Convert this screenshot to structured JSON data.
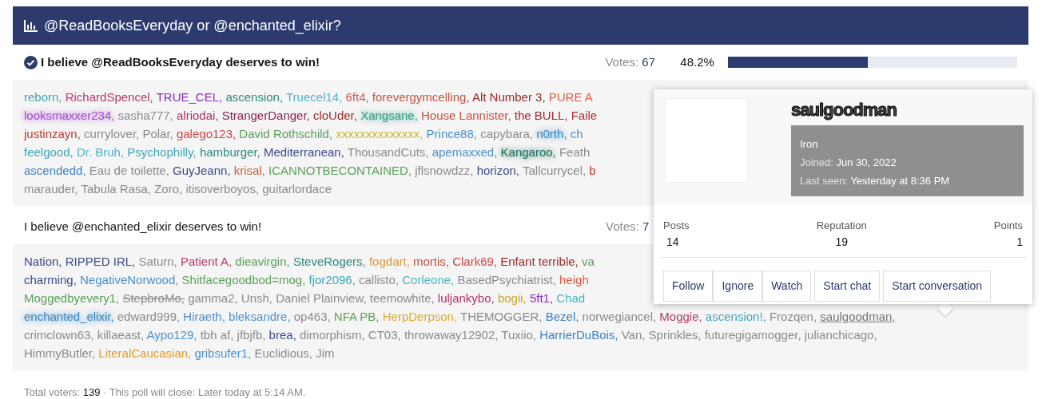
{
  "poll": {
    "title": "@ReadBooksEveryday or @enchanted_elixir?"
  },
  "options": [
    {
      "text": "I believe @ReadBooksEveryday deserves to win!",
      "selected": true,
      "votes_label": "Votes:",
      "votes": "67",
      "percent": "48.2%",
      "level": 0.482,
      "voter_lines": [
        [
          {
            "name": "reborn,",
            "color": "#3ea6b8"
          },
          {
            "name": "RichardSpencel,",
            "color": "#b83869"
          },
          {
            "name": "TRUE_CEL,",
            "color": "#8a2bc2"
          },
          {
            "name": "ascension,",
            "color": "#2a8a78"
          },
          {
            "name": "Truecel14,",
            "color": "#4bb5c6"
          },
          {
            "name": "6ft4,",
            "color": "#d9534f"
          },
          {
            "name": "forevergymcelling,",
            "color": "#c4533f"
          },
          {
            "name": "Alt Number 3,",
            "color": "#a02828"
          },
          {
            "name": "PURE A",
            "color": "#e8583f"
          }
        ],
        [
          {
            "name": "looksmaxxer234,",
            "color": "#a64fd0",
            "kind": "glow"
          },
          {
            "name": "sasha777,",
            "color": "#8a8a8a"
          },
          {
            "name": "alriodai,",
            "color": "#a8336b"
          },
          {
            "name": "StrangerDanger,",
            "color": "#8a2050"
          },
          {
            "name": "cloUder,",
            "color": "#9c2a2a"
          },
          {
            "name": "Xangsane,",
            "color": "#2e9e88",
            "kind": "glow"
          },
          {
            "name": "House Lannister,",
            "color": "#c9503c"
          },
          {
            "name": "the BULL,",
            "color": "#a02828"
          },
          {
            "name": "Faile",
            "color": "#b03030"
          }
        ],
        [
          {
            "name": "justinzayn,",
            "color": "#c0392b"
          },
          {
            "name": "currylover,",
            "color": "#8a8a8a"
          },
          {
            "name": "Polar,",
            "color": "#8a8a8a"
          },
          {
            "name": "galego123,",
            "color": "#d04545"
          },
          {
            "name": "David Rothschild,",
            "color": "#5aa05a"
          },
          {
            "name": "xxxxxxxxxxxxxx,",
            "color": "#c8b82a"
          },
          {
            "name": "Prince88,",
            "color": "#4a90d0"
          },
          {
            "name": "capybara,",
            "color": "#8a8a8a"
          },
          {
            "name": "n0rth,",
            "color": "#3a8ac8",
            "kind": "glow"
          },
          {
            "name": "ch",
            "color": "#4a90d0"
          }
        ],
        [
          {
            "name": "feelgood,",
            "color": "#3ea6b8"
          },
          {
            "name": "Dr. Bruh,",
            "color": "#4ab5c6"
          },
          {
            "name": "Psychophilly,",
            "color": "#3ea6b8"
          },
          {
            "name": "hamburger,",
            "color": "#2a8a78"
          },
          {
            "name": "Mediterranean,",
            "color": "#3a4a8a"
          },
          {
            "name": "ThousandCuts,",
            "color": "#8a8a8a"
          },
          {
            "name": "apemaxxed,",
            "color": "#4a90d0"
          },
          {
            "name": "Kangaroo,",
            "color": "#1f6f5f",
            "kind": "glow"
          },
          {
            "name": "Feath",
            "color": "#8a8a8a"
          }
        ],
        [
          {
            "name": "ascendedd,",
            "color": "#3a7fc8"
          },
          {
            "name": "Eau de toilette,",
            "color": "#8a8a8a"
          },
          {
            "name": "GuyJeann,",
            "color": "#3a4a8a"
          },
          {
            "name": "krisal,",
            "color": "#d0603a"
          },
          {
            "name": "ICANNOTBECONTAINED,",
            "color": "#5aa05a"
          },
          {
            "name": "jflsnowdzz,",
            "color": "#8a8a8a"
          },
          {
            "name": "horizon,",
            "color": "#3a4a8a"
          },
          {
            "name": "Tallcurrycel,",
            "color": "#8a8a8a"
          },
          {
            "name": "b",
            "color": "#c0392b"
          }
        ],
        [
          {
            "name": "marauder,",
            "color": "#8a8a8a"
          },
          {
            "name": "Tabula Rasa,",
            "color": "#8a8a8a"
          },
          {
            "name": "Zoro,",
            "color": "#8a8a8a"
          },
          {
            "name": "itisoverboyos,",
            "color": "#8a8a8a"
          },
          {
            "name": "guitarlordace",
            "color": "#8a8a8a"
          }
        ]
      ]
    },
    {
      "text": "I believe @enchanted_elixir deserves to win!",
      "selected": false,
      "votes_label": "Votes:",
      "votes": "7",
      "voter_lines": [
        [
          {
            "name": "Nation,",
            "color": "#3a4a8a"
          },
          {
            "name": "RIPPED IRL,",
            "color": "#3a4a8a"
          },
          {
            "name": "Saturn,",
            "color": "#8a8a8a"
          },
          {
            "name": "Patient A,",
            "color": "#b83869"
          },
          {
            "name": "dieavirgin,",
            "color": "#5aa05a"
          },
          {
            "name": "SteveRogers,",
            "color": "#2a8a78"
          },
          {
            "name": "fogdart,",
            "color": "#e09a30"
          },
          {
            "name": "mortis,",
            "color": "#c9503c"
          },
          {
            "name": "Clark69,",
            "color": "#d04545"
          },
          {
            "name": "Enfant terrible,",
            "color": "#a02828"
          },
          {
            "name": "va",
            "color": "#5aa05a"
          }
        ],
        [
          {
            "name": "charming,",
            "color": "#3a4a8a"
          },
          {
            "name": "NegativeNorwood,",
            "color": "#4a90d0"
          },
          {
            "name": "Shitfacegoodbod=mog,",
            "color": "#5aa05a"
          },
          {
            "name": "fjor2096,",
            "color": "#3ea6b8"
          },
          {
            "name": "callisto,",
            "color": "#8a8a8a"
          },
          {
            "name": "Corleone,",
            "color": "#4ab5c6"
          },
          {
            "name": "BasedPsychiatrist,",
            "color": "#8a8a8a"
          },
          {
            "name": "heigh",
            "color": "#e8583f"
          }
        ],
        [
          {
            "name": "Moggedbyevery1,",
            "color": "#5aa05a"
          },
          {
            "name": "StepbroMo,",
            "color": "#8a8a8a",
            "kind": "strike"
          },
          {
            "name": "gamma2,",
            "color": "#8a8a8a"
          },
          {
            "name": "Unsh,",
            "color": "#8a8a8a"
          },
          {
            "name": "Daniel Plainview,",
            "color": "#8a8a8a"
          },
          {
            "name": "teemowhite,",
            "color": "#8a8a8a"
          },
          {
            "name": "luljankybo,",
            "color": "#b8306b"
          },
          {
            "name": "bogii,",
            "color": "#d0a020"
          },
          {
            "name": "5ft1,",
            "color": "#8a2bc2"
          },
          {
            "name": "Chad",
            "color": "#4ab5c6"
          }
        ],
        [
          {
            "name": "enchanted_elixir,",
            "color": "#3a8ac8",
            "kind": "glow"
          },
          {
            "name": "edward999,",
            "color": "#8a8a8a"
          },
          {
            "name": "Hiraeth,",
            "color": "#4a90d0"
          },
          {
            "name": "bleksandre,",
            "color": "#4a90d0"
          },
          {
            "name": "op463,",
            "color": "#8a8a8a"
          },
          {
            "name": "NFA PB,",
            "color": "#5aa05a"
          },
          {
            "name": "HerpDerpson,",
            "color": "#e0a830"
          },
          {
            "name": "THEMOGGER,",
            "color": "#8a8a8a"
          },
          {
            "name": "Bezel,",
            "color": "#3a7fc8"
          },
          {
            "name": "norwegiancel,",
            "color": "#8a8a8a"
          },
          {
            "name": "Moggie,",
            "color": "#b83869"
          },
          {
            "name": "ascension!,",
            "color": "#3ea6b8"
          },
          {
            "name": "Frozqen,",
            "color": "#8a8a8a"
          },
          {
            "name": "saulgoodman,",
            "color": "#777777",
            "kind": "underline"
          }
        ],
        [
          {
            "name": "crimclown63,",
            "color": "#8a8a8a"
          },
          {
            "name": "killaeast,",
            "color": "#8a8a8a"
          },
          {
            "name": "Aypo129,",
            "color": "#4a90d0"
          },
          {
            "name": "tbh af,",
            "color": "#8a8a8a"
          },
          {
            "name": "jfbjfb,",
            "color": "#8a8a8a"
          },
          {
            "name": "brea,",
            "color": "#3a4a8a"
          },
          {
            "name": "dimorphism,",
            "color": "#8a8a8a"
          },
          {
            "name": "CT03,",
            "color": "#8a8a8a"
          },
          {
            "name": "throwaway12902,",
            "color": "#8a8a8a"
          },
          {
            "name": "Tuxiio,",
            "color": "#8a8a8a"
          },
          {
            "name": "HarrierDuBois,",
            "color": "#3a7fc8"
          },
          {
            "name": "Van,",
            "color": "#8a8a8a"
          },
          {
            "name": "Sprinkles,",
            "color": "#8a8a8a"
          },
          {
            "name": "futuregigamogger,",
            "color": "#8a8a8a"
          },
          {
            "name": "julianchicago,",
            "color": "#8a8a8a"
          }
        ],
        [
          {
            "name": "HimmyButler,",
            "color": "#8a8a8a"
          },
          {
            "name": "LiteralCaucasian,",
            "color": "#e09a30"
          },
          {
            "name": "gribsufer1,",
            "color": "#4a90d0"
          },
          {
            "name": "Euclidious,",
            "color": "#8a8a8a"
          },
          {
            "name": "Jim",
            "color": "#8a8a8a"
          }
        ]
      ]
    }
  ],
  "footer": {
    "label": "Total voters:",
    "value": "139",
    "close": "· This poll will close: Later today at 5:14 AM."
  },
  "member_card": {
    "username": "saulgoodman",
    "rank": "Iron",
    "joined_label": "Joined:",
    "joined": "Jun 30, 2022",
    "last_seen_label": "Last seen:",
    "last_seen": "Yesterday at 8:36 PM",
    "stats": [
      {
        "label": "Posts",
        "value": "14"
      },
      {
        "label": "Reputation",
        "value": "19"
      },
      {
        "label": "Points",
        "value": "1"
      }
    ],
    "button_groups": [
      [
        "Follow",
        "Ignore",
        "Watch"
      ],
      [
        "Start chat"
      ],
      [
        "Start conversation"
      ]
    ]
  }
}
